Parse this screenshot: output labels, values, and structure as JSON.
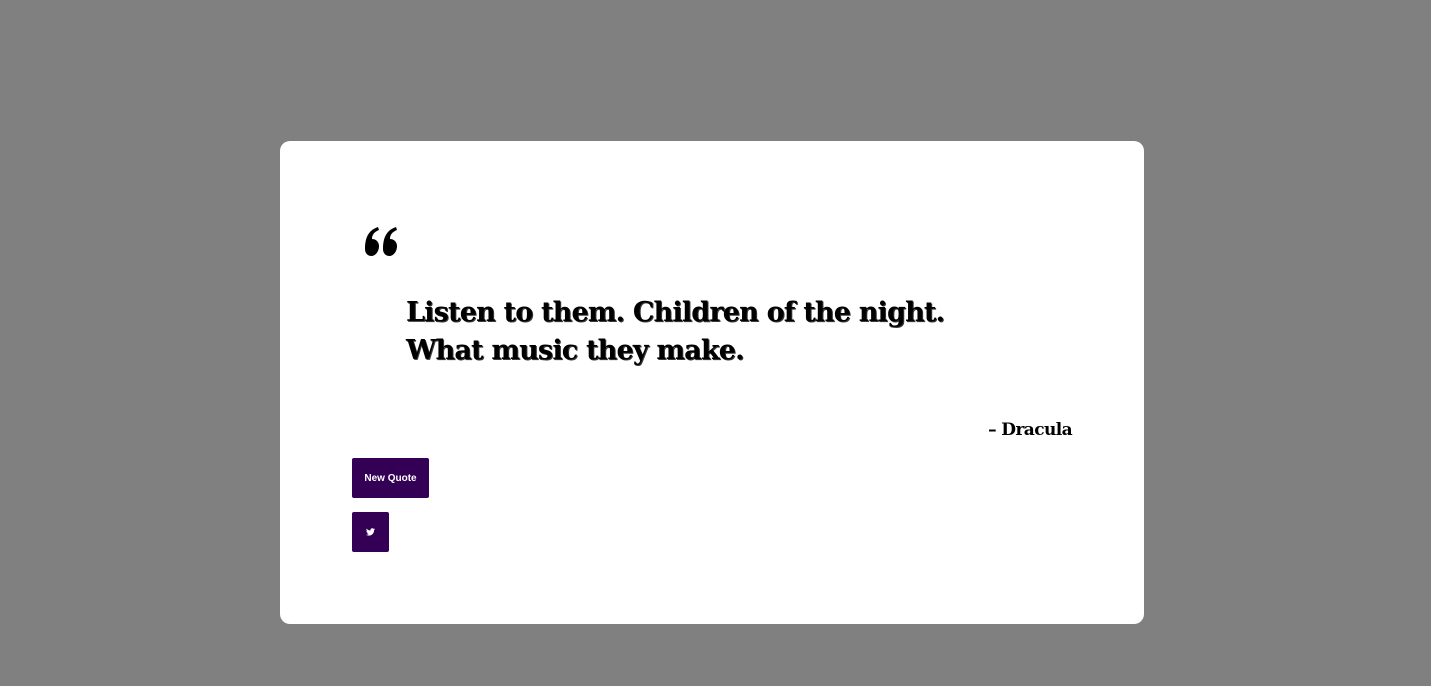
{
  "quote": {
    "text": "Listen to them. Children of the night. What music they make.",
    "author": "– Dracula"
  },
  "buttons": {
    "new_quote_label": "New Quote",
    "tweet_icon": "twitter-icon"
  },
  "colors": {
    "background": "#808080",
    "card": "#ffffff",
    "button": "#330055",
    "text": "#000000"
  }
}
